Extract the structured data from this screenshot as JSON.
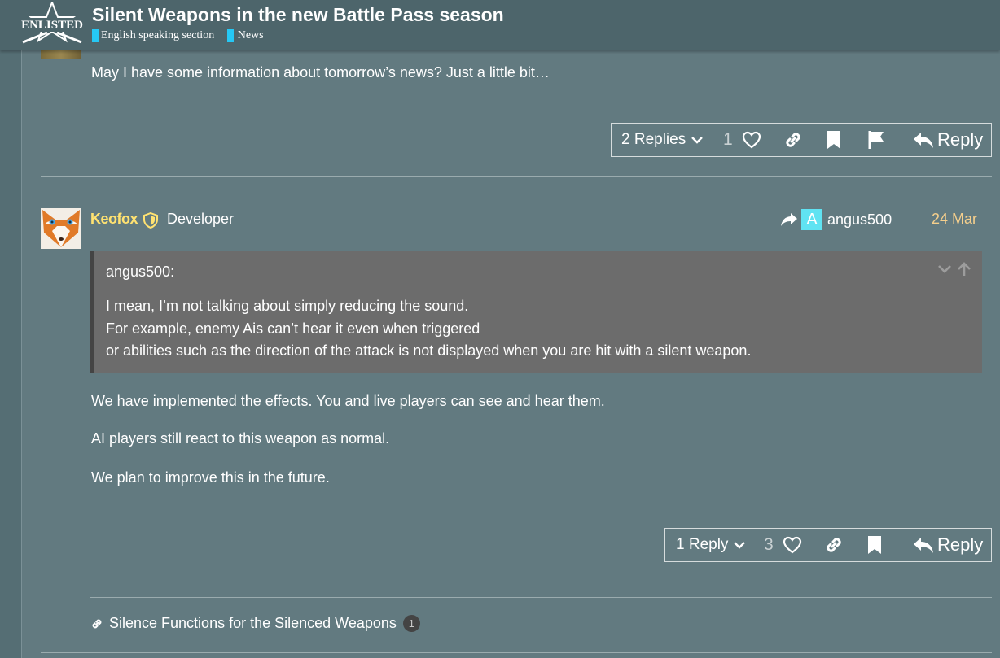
{
  "header": {
    "logo_text": "ENLISTED",
    "title": "Silent Weapons in the new Battle Pass season",
    "categories": [
      {
        "label": "English speaking section",
        "color": "#25c8f5"
      },
      {
        "label": "News",
        "color": "#25c8f5"
      }
    ]
  },
  "post_prev": {
    "body": "May I have some information about tomorrow’s news? Just a little bit…",
    "actions": {
      "replies_label": "2 Replies",
      "like_count": "1",
      "reply_label": "Reply"
    }
  },
  "post": {
    "username": "Keofox",
    "user_title": "Developer",
    "reply_to_user": "angus500",
    "reply_to_avatar_letter": "A",
    "date": "24 Mar",
    "quote": {
      "author": "angus500:",
      "lines": [
        "I mean, I’m not talking about simply reducing the sound.",
        "For example, enemy Ais can’t hear it even when triggered",
        "or abilities such as the direction of the attack is not displayed when you are hit with a silent weapon."
      ]
    },
    "paragraphs": [
      "We have implemented the effects. You and live players can see and hear them.",
      "AI players still react to this weapon as normal.",
      "We plan to improve this in the future."
    ],
    "actions": {
      "replies_label": "1 Reply",
      "like_count": "3",
      "reply_label": "Reply"
    },
    "linked_topic": {
      "title": "Silence Functions for the Silenced Weapons",
      "count": "1"
    }
  },
  "colors": {
    "background": "#627a80",
    "header": "#4d656b",
    "username": "#ffe271",
    "date": "#f5cf8c",
    "quote_bg": "#6c6c6c",
    "accent_cyan": "#60e3f2"
  }
}
